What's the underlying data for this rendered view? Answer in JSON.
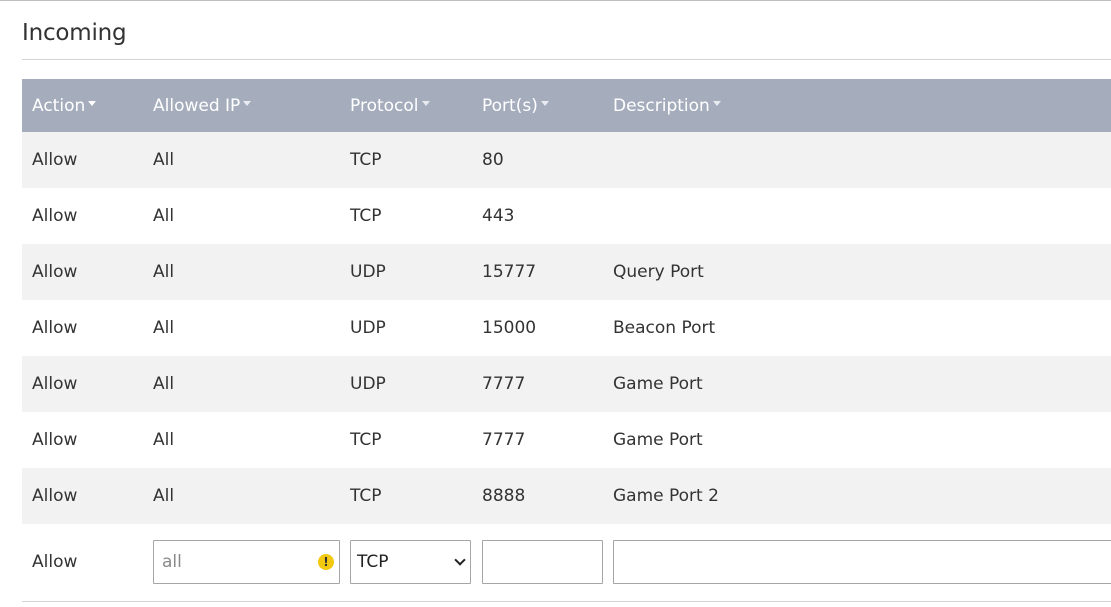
{
  "section": {
    "title": "Incoming"
  },
  "table": {
    "columns": [
      {
        "label": "Action"
      },
      {
        "label": "Allowed IP"
      },
      {
        "label": "Protocol"
      },
      {
        "label": "Port(s)"
      },
      {
        "label": "Description"
      }
    ],
    "rows": [
      {
        "action": "Allow",
        "ip": "All",
        "protocol": "TCP",
        "port": "80",
        "description": ""
      },
      {
        "action": "Allow",
        "ip": "All",
        "protocol": "TCP",
        "port": "443",
        "description": ""
      },
      {
        "action": "Allow",
        "ip": "All",
        "protocol": "UDP",
        "port": "15777",
        "description": "Query Port"
      },
      {
        "action": "Allow",
        "ip": "All",
        "protocol": "UDP",
        "port": "15000",
        "description": "Beacon Port"
      },
      {
        "action": "Allow",
        "ip": "All",
        "protocol": "UDP",
        "port": "7777",
        "description": "Game Port"
      },
      {
        "action": "Allow",
        "ip": "All",
        "protocol": "TCP",
        "port": "7777",
        "description": "Game Port"
      },
      {
        "action": "Allow",
        "ip": "All",
        "protocol": "TCP",
        "port": "8888",
        "description": "Game Port 2"
      }
    ],
    "new_row": {
      "action": "Allow",
      "ip_placeholder": "all",
      "ip_warning_icon": "warning-icon",
      "protocol_selected": "TCP",
      "port_value": "",
      "description_value": ""
    }
  },
  "colors": {
    "header_bg": "#a5adbd",
    "row_stripe": "#f2f2f2",
    "warning": "#f2c811"
  }
}
